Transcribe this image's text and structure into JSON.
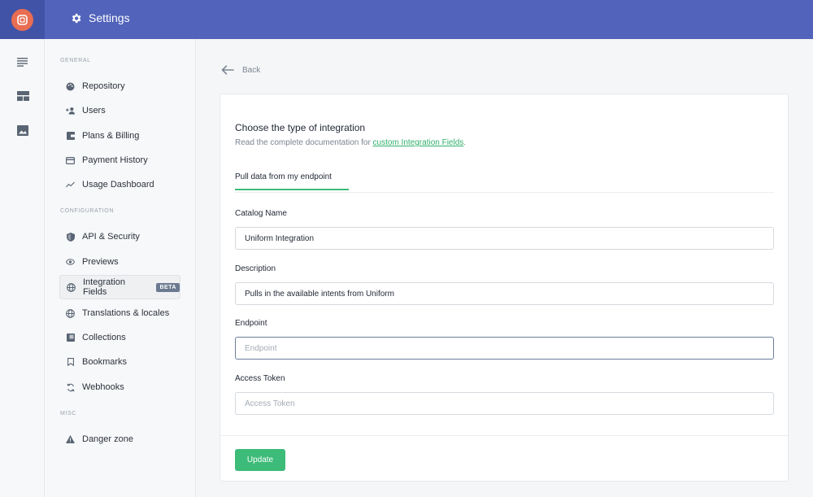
{
  "header": {
    "title": "Settings"
  },
  "sidebar": {
    "sections": {
      "general": "GENERAL",
      "configuration": "CONFIGURATION",
      "misc": "MISC"
    },
    "items": [
      {
        "label": "Repository",
        "icon": "palette-icon"
      },
      {
        "label": "Users",
        "icon": "add-user-icon"
      },
      {
        "label": "Plans & Billing",
        "icon": "wallet-icon"
      },
      {
        "label": "Payment History",
        "icon": "credit-card-icon"
      },
      {
        "label": "Usage Dashboard",
        "icon": "trend-line-icon"
      },
      {
        "label": "API & Security",
        "icon": "shield-icon"
      },
      {
        "label": "Previews",
        "icon": "eye-icon"
      },
      {
        "label": "Integration Fields",
        "icon": "globe-icon",
        "badge": "BETA",
        "active": true
      },
      {
        "label": "Translations & locales",
        "icon": "globe-icon"
      },
      {
        "label": "Collections",
        "icon": "collection-icon"
      },
      {
        "label": "Bookmarks",
        "icon": "bookmark-icon"
      },
      {
        "label": "Webhooks",
        "icon": "refresh-icon"
      },
      {
        "label": "Danger zone",
        "icon": "warning-icon"
      }
    ]
  },
  "main": {
    "back_label": "Back",
    "card": {
      "title": "Choose the type of integration",
      "subtitle_prefix": "Read the complete documentation for ",
      "subtitle_link": "custom Integration Fields",
      "subtitle_suffix": ".",
      "tab_label": "Pull data from my endpoint",
      "fields": {
        "catalog_name": {
          "label": "Catalog Name",
          "value": "Uniform Integration"
        },
        "description": {
          "label": "Description",
          "value": "Pulls in the available intents from Uniform"
        },
        "endpoint": {
          "label": "Endpoint",
          "value": "",
          "placeholder": "Endpoint"
        },
        "access_token": {
          "label": "Access Token",
          "value": "",
          "placeholder": "Access Token"
        }
      },
      "submit_label": "Update"
    }
  },
  "colors": {
    "topbar": "#5163ba",
    "logo": "#e86d52",
    "accent_green": "#3dbb78",
    "link_green": "#2fb06a"
  }
}
